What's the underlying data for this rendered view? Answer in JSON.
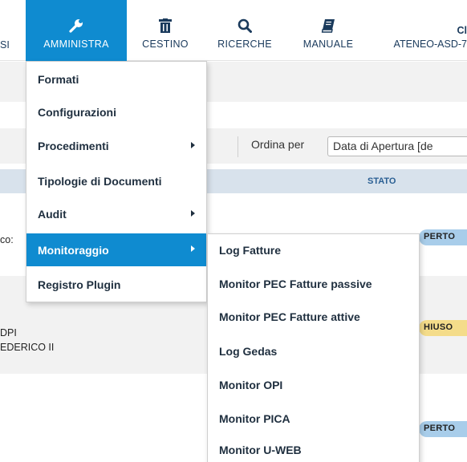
{
  "nav": {
    "left_fragment": "SI",
    "items": [
      {
        "label": "AMMINISTRA",
        "icon": "wrench-icon",
        "active": true
      },
      {
        "label": "CESTINO",
        "icon": "trash-icon"
      },
      {
        "label": "RICERCHE",
        "icon": "search-icon"
      },
      {
        "label": "MANUALE",
        "icon": "book-icon"
      }
    ],
    "right_title": "Cl",
    "right_subtitle": "ATENEO-ASD-7"
  },
  "accent_color": "#0f8bd0",
  "toolbar": {
    "sort_label": "Ordina per",
    "sort_value": "Data di Apertura [de"
  },
  "table": {
    "status_header": "STATO",
    "rows": [
      {
        "text_fragment": "co:",
        "status": "PERTO"
      },
      {
        "text_line1": "DPI",
        "text_line2": "EDERICO II",
        "status": "HIUSO"
      },
      {
        "status": "PERTO"
      }
    ]
  },
  "menu": {
    "items": [
      {
        "label": "Formati"
      },
      {
        "label": "Configurazioni"
      },
      {
        "label": "Procedimenti",
        "has_submenu": true
      },
      {
        "label": "Tipologie di Documenti"
      },
      {
        "label": "Audit",
        "has_submenu": true
      },
      {
        "label": "Monitoraggio",
        "has_submenu": true,
        "active": true
      },
      {
        "label": "Registro Plugin"
      }
    ]
  },
  "submenu": {
    "items": [
      {
        "label": "Log Fatture"
      },
      {
        "label": "Monitor PEC Fatture passive"
      },
      {
        "label": "Monitor PEC Fatture attive"
      },
      {
        "label": "Log Gedas"
      },
      {
        "label": "Monitor OPI"
      },
      {
        "label": "Monitor PICA"
      },
      {
        "label": "Monitor U-WEB"
      }
    ]
  }
}
